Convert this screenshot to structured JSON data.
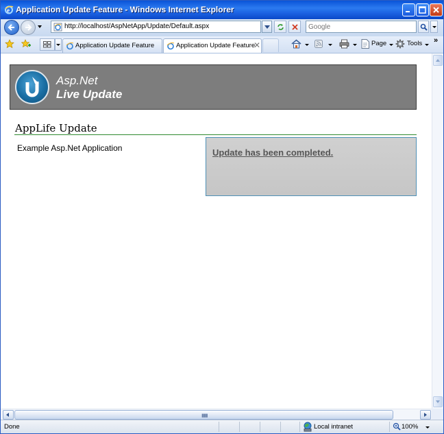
{
  "window": {
    "title": "Application Update Feature - Windows Internet Explorer"
  },
  "address_bar": {
    "url": "http://localhost/AspNetApp/Update/Default.aspx"
  },
  "search": {
    "placeholder": "Google"
  },
  "tabs": [
    {
      "label": "Application Update Feature",
      "active": false
    },
    {
      "label": "Application Update Feature",
      "active": true,
      "close_glyph": "✕"
    }
  ],
  "command_bar": {
    "page_label": "Page",
    "tools_label": "Tools",
    "overflow": "»"
  },
  "page": {
    "banner": {
      "line1": "Asp.Net",
      "line2": "Live Update"
    },
    "heading": "AppLife Update",
    "app_label": "Example Asp.Net Application",
    "status_message": "Update has been completed."
  },
  "status_bar": {
    "text": "Done",
    "zone": "Local intranet",
    "zoom": "100%"
  },
  "colors": {
    "title_bar": "#1a5fe0",
    "banner_bg": "#7d7d7d",
    "heading_rule": "#2f8a2f",
    "panel_bg": "#c8c8c8",
    "panel_border": "#4d8fb5",
    "logo": "#1a6ea3"
  }
}
